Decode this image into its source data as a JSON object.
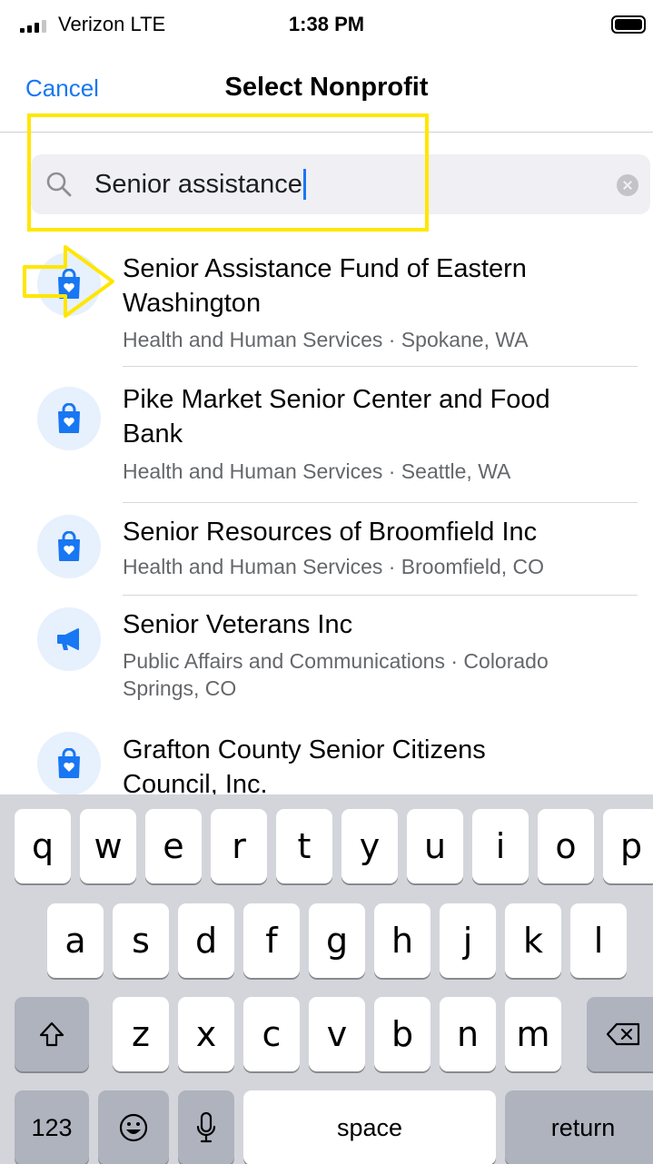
{
  "status_bar": {
    "carrier": "Verizon  LTE",
    "time": "1:38 PM"
  },
  "nav": {
    "cancel_label": "Cancel",
    "title": "Select Nonprofit"
  },
  "search": {
    "value": "Senior assistance"
  },
  "results": [
    {
      "name_lines": [
        "Senior Assistance Fund of Eastern",
        "Washington"
      ],
      "meta_lines": [
        "Health and Human Services · Spokane, WA"
      ],
      "icon": "shopping-bag-heart-icon"
    },
    {
      "name_lines": [
        "Pike Market Senior Center and Food",
        "Bank"
      ],
      "meta_lines": [
        "Health and Human Services · Seattle, WA"
      ],
      "icon": "shopping-bag-heart-icon"
    },
    {
      "name_lines": [
        "Senior Resources of Broomfield Inc"
      ],
      "meta_lines": [
        "Health and Human Services · Broomfield, CO"
      ],
      "icon": "shopping-bag-heart-icon"
    },
    {
      "name_lines": [
        "Senior Veterans Inc"
      ],
      "meta_lines": [
        "Public Affairs and Communications · Colorado",
        "Springs, CO"
      ],
      "icon": "megaphone-icon"
    },
    {
      "name_lines": [
        "Grafton County Senior Citizens",
        "Council, Inc."
      ],
      "meta_lines": [],
      "icon": "shopping-bag-heart-icon"
    }
  ],
  "keyboard": {
    "row1": [
      "q",
      "w",
      "e",
      "r",
      "t",
      "y",
      "u",
      "i",
      "o",
      "p"
    ],
    "row2": [
      "a",
      "s",
      "d",
      "f",
      "g",
      "h",
      "j",
      "k",
      "l"
    ],
    "row3": [
      "z",
      "x",
      "c",
      "v",
      "b",
      "n",
      "m"
    ],
    "numbers_label": "123",
    "space_label": "space",
    "return_label": "return"
  },
  "colors": {
    "accent": "#1877f2",
    "annotation": "#ffe600",
    "keyboard_bg": "#d3d5db"
  }
}
